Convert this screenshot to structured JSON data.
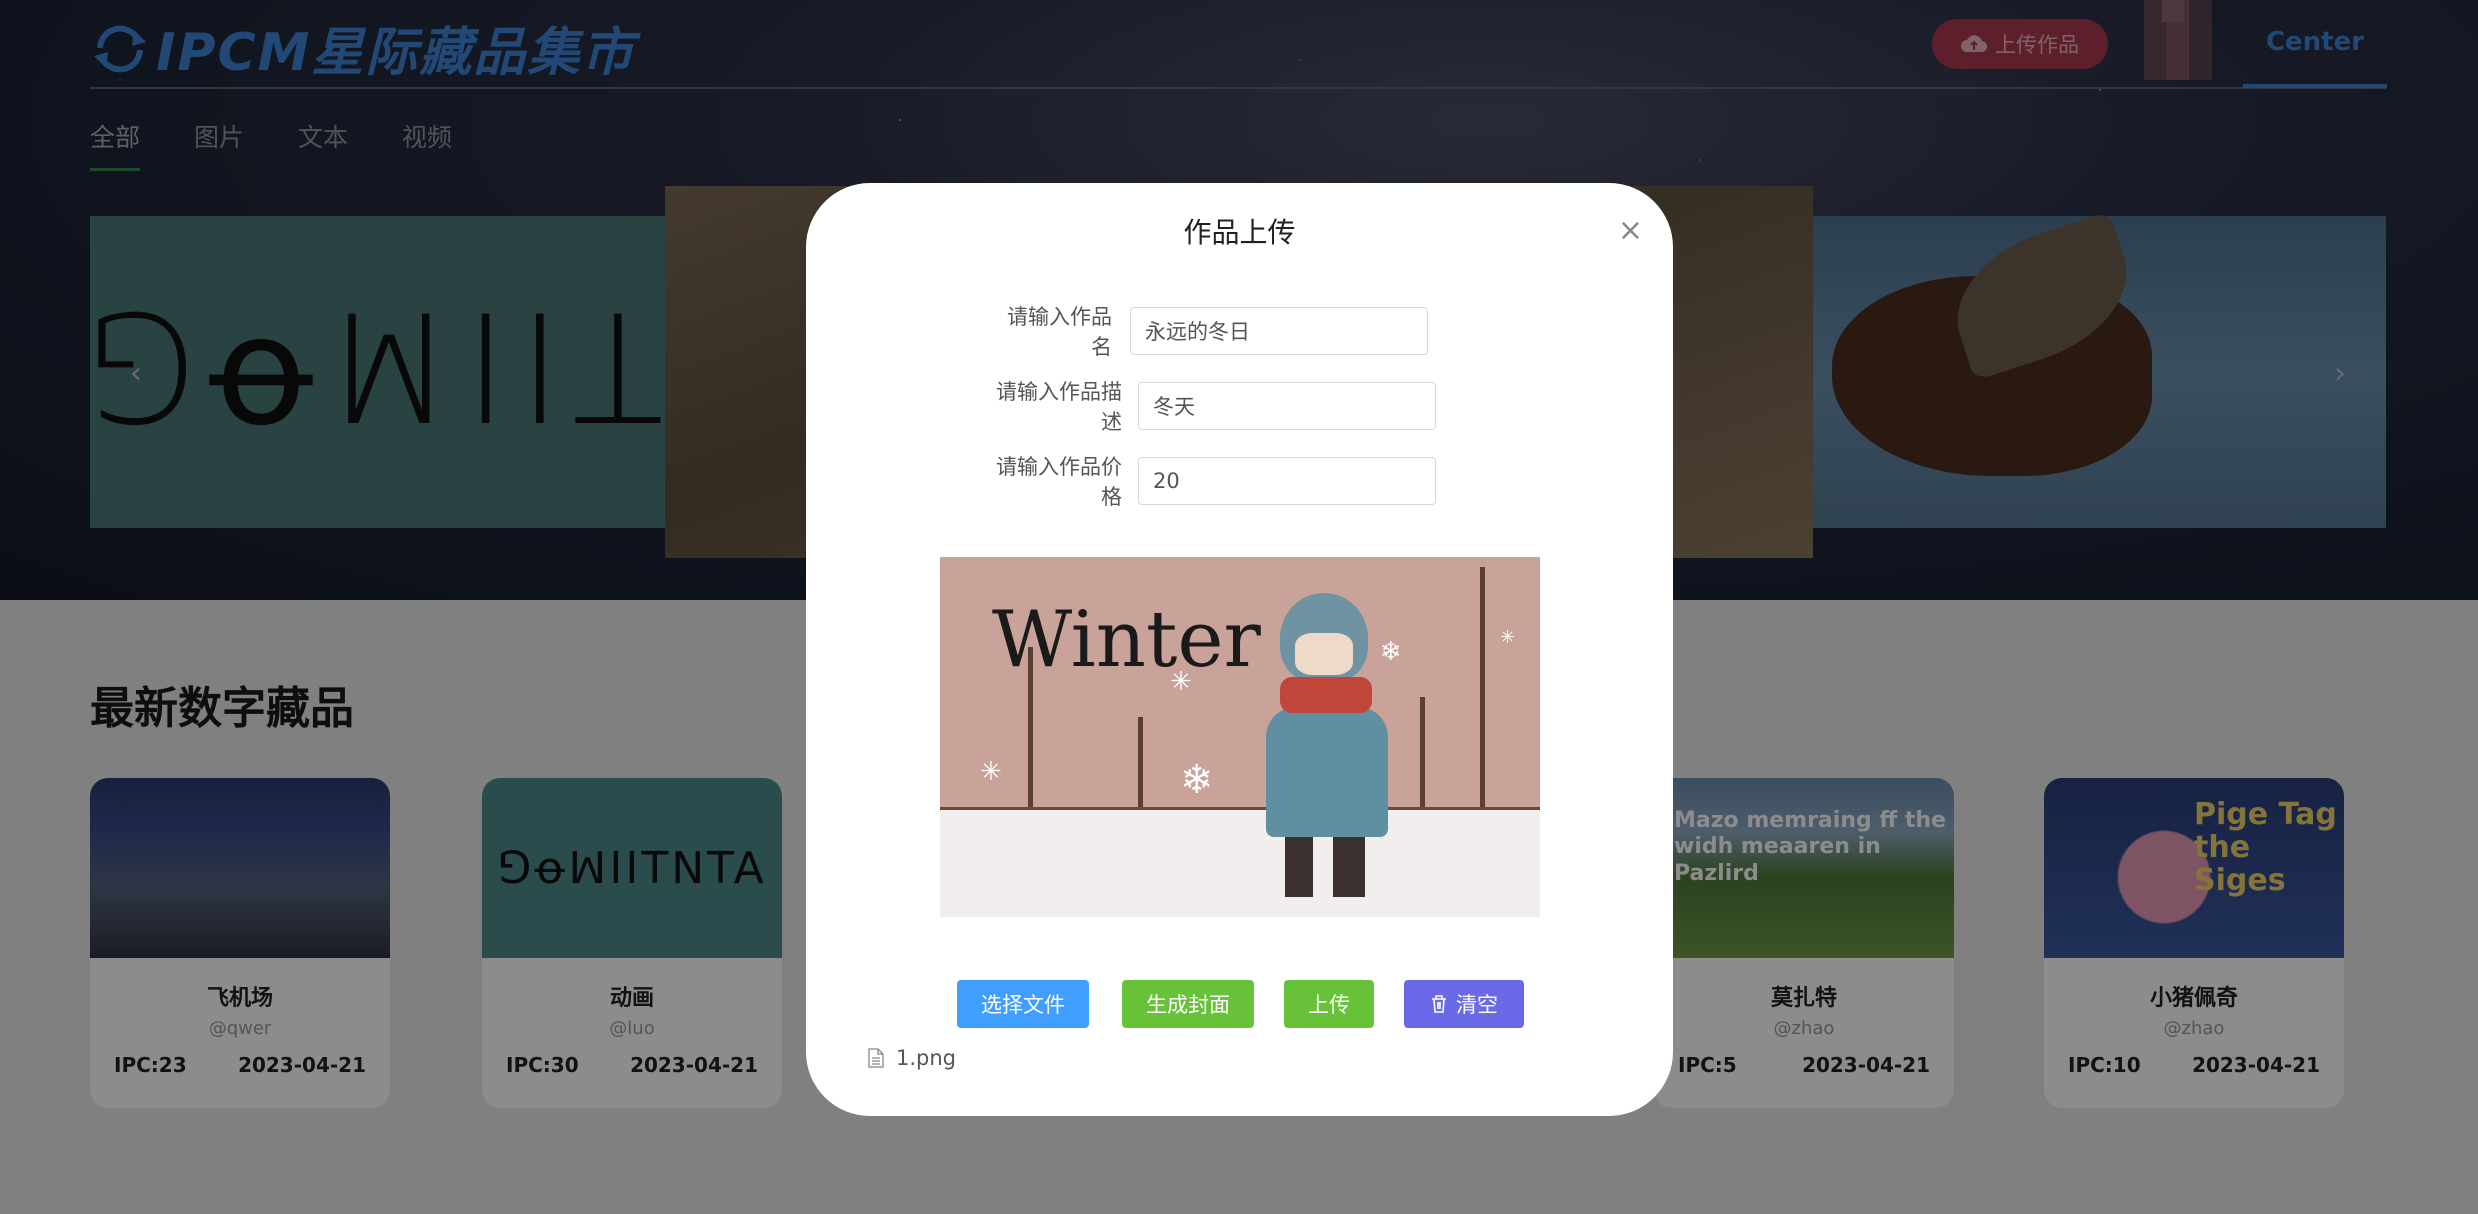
{
  "header": {
    "logo_text": "IPCM星际藏品集市",
    "upload_button": "上传作品",
    "center_link": "Center"
  },
  "category_tabs": [
    {
      "label": "全部",
      "active": true
    },
    {
      "label": "图片",
      "active": false
    },
    {
      "label": "文本",
      "active": false
    },
    {
      "label": "视频",
      "active": false
    }
  ],
  "carousel": {
    "left_slide_text": "ꓨꝋꟽꓲꓲꓕ"
  },
  "section": {
    "title": "最新数字藏品"
  },
  "cards": [
    {
      "name": "飞机场",
      "user": "@qwer",
      "price": "IPC:23",
      "date": "2023-04-21"
    },
    {
      "name": "动画",
      "user": "@luo",
      "price": "IPC:30",
      "date": "2023-04-21"
    },
    {
      "name": "莫扎特",
      "user": "@zhao",
      "price": "IPC:5",
      "date": "2023-04-21"
    },
    {
      "name": "小猪佩奇",
      "user": "@zhao",
      "price": "IPC:10",
      "date": "2023-04-21"
    }
  ],
  "card_images": {
    "anim_text": "ꓨꝋꟽꓲꓲTNTA",
    "mozart_text": "Mazo memraing ff the widh meaaren in Pazlird",
    "pig_text": "Pige Tag the Siges"
  },
  "modal": {
    "title": "作品上传",
    "close_icon": "×",
    "name_label": "请输入作品名",
    "name_value": "永远的冬日",
    "desc_label": "请输入作品描述",
    "desc_value": "冬天",
    "price_label": "请输入作品价格",
    "price_value": "20",
    "preview_text": "Winter",
    "buttons": {
      "choose_file": "选择文件",
      "generate_cover": "生成封面",
      "upload": "上传",
      "clear": "清空"
    },
    "file_name": "1.png"
  },
  "colors": {
    "primary_blue": "#409eff",
    "success_green": "#67c23a",
    "clear_purple": "#6a6ae8",
    "logo_blue": "#3f86d8"
  }
}
